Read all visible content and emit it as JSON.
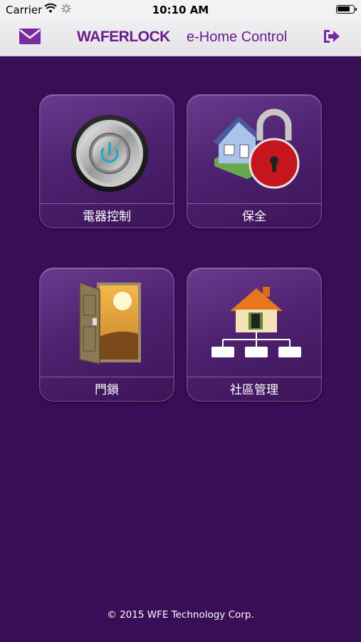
{
  "status_bar": {
    "carrier": "Carrier",
    "time": "10:10 AM",
    "icons": [
      "wifi-icon",
      "activity-spinner-icon",
      "battery-icon"
    ]
  },
  "nav_bar": {
    "brand": "WAFERLOCK",
    "subtitle": "e-Home Control",
    "left_icon": "mail-icon",
    "right_icon": "logout-icon",
    "accent_color": "#6b1a8c"
  },
  "tiles": [
    {
      "label": "電器控制",
      "icon": "power-button-icon"
    },
    {
      "label": "保全",
      "icon": "house-padlock-icon"
    },
    {
      "label": "門鎖",
      "icon": "open-door-icon"
    },
    {
      "label": "社區管理",
      "icon": "community-network-icon"
    }
  ],
  "footer": {
    "copyright": "© 2015 WFE Technology Corp."
  },
  "colors": {
    "background": "#3a0e56",
    "tile": "#4e2270",
    "nav": "#efeff1"
  }
}
